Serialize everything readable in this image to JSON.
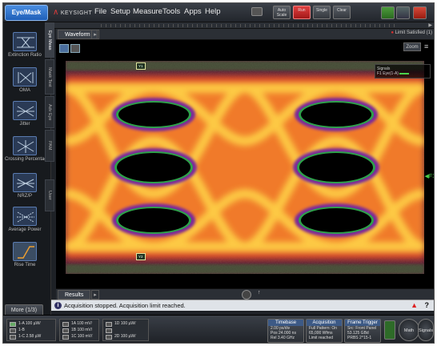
{
  "titlebar": {
    "mode_button": "Eye/Mask",
    "logo": "KEYSIGHT",
    "menus": [
      "File",
      "Setup",
      "Measure",
      "Tools",
      "Apps",
      "Help"
    ],
    "buttons": {
      "auto_scale": "Auto\nScale",
      "run": "Run",
      "single": "Single",
      "clear": "Clear"
    }
  },
  "left_panel": {
    "measurements": [
      {
        "label": "Extinction Ratio"
      },
      {
        "label": "OMA"
      },
      {
        "label": "Jitter"
      },
      {
        "label": "Crossing\nPercentage"
      },
      {
        "label": "NRZ/P"
      },
      {
        "label": "Average Power"
      },
      {
        "label": "Rise Time"
      }
    ],
    "more_button": "More (1/3)"
  },
  "vertical_tabs": [
    "Eye Meas",
    "Mask Test",
    "Adv Eye",
    "PAM",
    "User"
  ],
  "waveform": {
    "tab_label": "Waveform",
    "limit_text": "Limit Satisfied (1)",
    "zoom_label": "Zoom",
    "legend_line1": "Signals",
    "legend_line2": "F1 Eye(1-A)",
    "channel_marker": "F1",
    "markers": [
      "Y1",
      "Y2"
    ]
  },
  "results": {
    "tab_label": "Results"
  },
  "status": {
    "message": "Acquisition stopped. Acquisition limit reached."
  },
  "bottom": {
    "channels": [
      {
        "rows": [
          "1-A 100 µW/",
          "1-B",
          "1-C 2.58 µW"
        ]
      },
      {
        "rows": [
          "1A 100 mV/",
          "1B 100 mV/",
          "1C 100 mV/"
        ]
      },
      {
        "rows": [
          "1D 100 µW/",
          "",
          "2D 100 µW/"
        ]
      }
    ],
    "timebase": {
      "title": "Timebase",
      "lines": [
        "2.00 ps/div",
        "Pos 24.000 ns",
        "Rel 3.40 GHz"
      ]
    },
    "acquisition": {
      "title": "Acquisition",
      "lines": [
        "Full Pattern: On",
        "65,000 Wfms",
        "Limit reached"
      ]
    },
    "trigger": {
      "title": "Frame Trigger",
      "lines": [
        "Src: Front Panel",
        "53.125 GBd",
        "PRBS 2^15-1"
      ]
    },
    "math_button": "Math",
    "signals_button": "Signals"
  }
}
